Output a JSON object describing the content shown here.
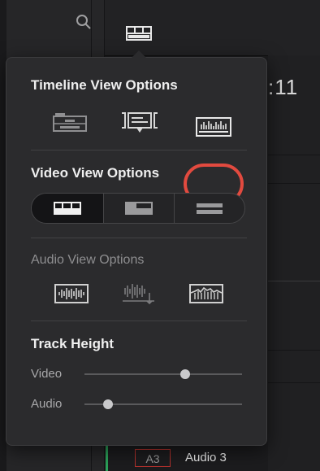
{
  "background": {
    "timecode": ":11",
    "track_badge": "A3",
    "track_name": "Audio 3",
    "icons": {
      "search": "search-icon",
      "view_options": "timeline-view-options-icon"
    }
  },
  "popover": {
    "timeline_view": {
      "title": "Timeline View Options",
      "options": [
        {
          "icon": "stacked-timelines-icon",
          "selected": false
        },
        {
          "icon": "subtitle-tracks-icon",
          "selected": false
        },
        {
          "icon": "audio-waveforms-icon",
          "selected": true,
          "highlighted": true
        }
      ]
    },
    "video_view": {
      "title": "Video View Options",
      "options": [
        {
          "icon": "filmstrip-view-icon",
          "selected": true
        },
        {
          "icon": "thumbnail-view-icon",
          "selected": false
        },
        {
          "icon": "simple-view-icon",
          "selected": false
        }
      ]
    },
    "audio_view": {
      "title": "Audio View Options",
      "enabled": false,
      "options": [
        {
          "icon": "waveform-full-icon"
        },
        {
          "icon": "waveform-bottom-icon"
        },
        {
          "icon": "waveform-overlay-icon"
        }
      ]
    },
    "track_height": {
      "title": "Track Height",
      "video_label": "Video",
      "video_value": 0.64,
      "audio_label": "Audio",
      "audio_value": 0.15
    }
  },
  "colors": {
    "accent_highlight": "#e24a3f",
    "track_badge_border": "#b4322d",
    "playhead_green": "#2ba35a"
  }
}
